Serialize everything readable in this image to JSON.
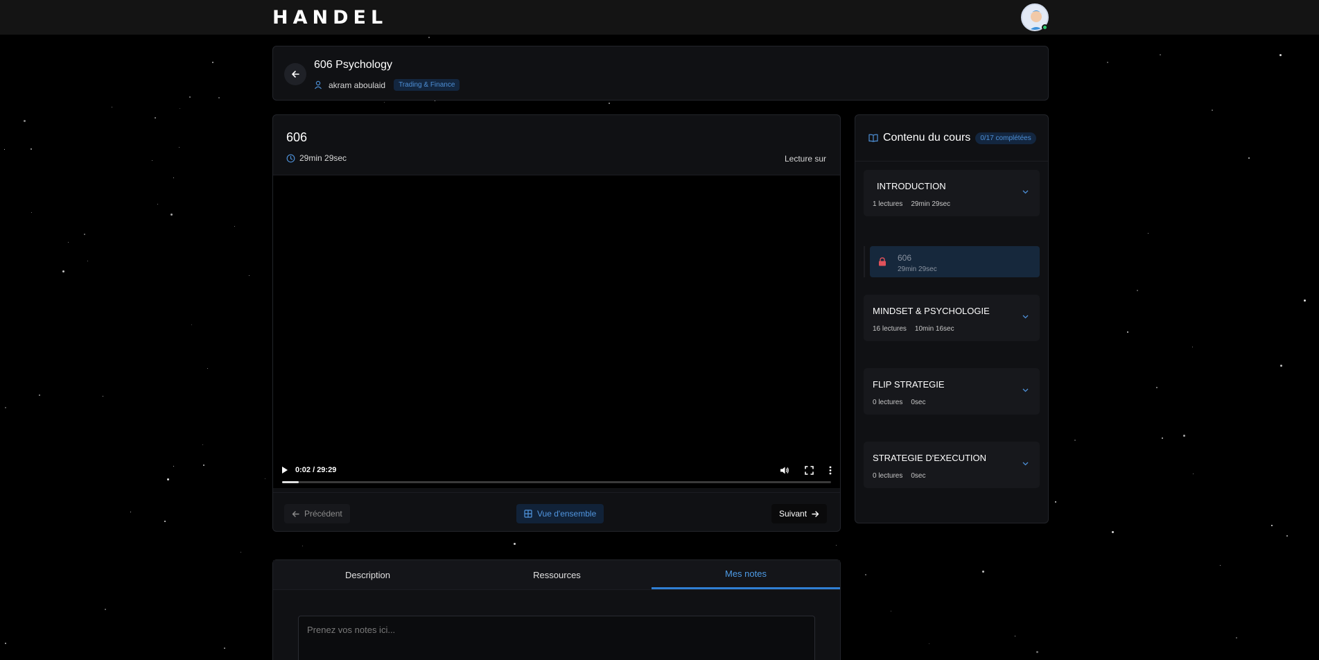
{
  "brand": {
    "name": "HANDEL"
  },
  "user": {
    "avatar_alt": "user avatar"
  },
  "course": {
    "title": "606 Psychology",
    "author": "akram aboulaid",
    "category": "Trading & Finance"
  },
  "lesson": {
    "title": "606",
    "duration": "29min 29sec",
    "reading_on": "Lecture sur"
  },
  "player": {
    "time": "0:02 / 29:29",
    "progress": 0.03
  },
  "nav": {
    "prev_label": "Précédent",
    "overview_label": "Vue d'ensemble",
    "next_label": "Suivant"
  },
  "sidebar": {
    "title": "Contenu du cours",
    "progress_badge": "0/17 complétées",
    "sections": [
      {
        "title": "INTRODUCTION",
        "lectures": "1 lectures",
        "duration": "29min 29sec"
      },
      {
        "title": "MINDSET & PSYCHOLOGIE",
        "lectures": "16 lectures",
        "duration": "10min 16sec"
      },
      {
        "title": "FLIP STRATEGIE",
        "lectures": "0 lectures",
        "duration": "0sec"
      },
      {
        "title": "STRATEGIE D'EXECUTION",
        "lectures": "0 lectures",
        "duration": "0sec"
      }
    ],
    "current_lesson": {
      "title": "606",
      "duration": "29min 29sec"
    }
  },
  "tabs": [
    {
      "label": "Description"
    },
    {
      "label": "Ressources"
    },
    {
      "label": "Mes notes"
    }
  ],
  "notes": {
    "placeholder": "Prenez vos notes ici..."
  },
  "colors": {
    "accent": "#2f7fd4",
    "background": "#000000",
    "panel": "#101114",
    "lock": "#e0525b"
  }
}
